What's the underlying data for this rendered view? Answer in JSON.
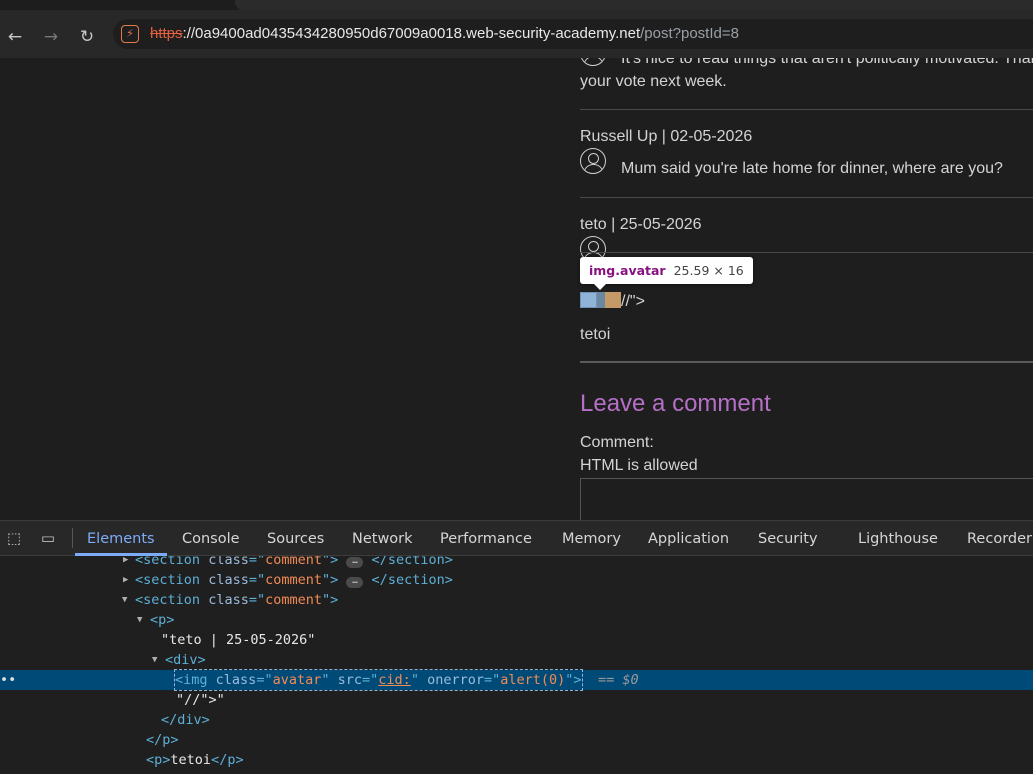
{
  "browser": {
    "url_scheme": "https",
    "url_host": "://0a9400ad0435434280950d67009a0018.web-security-academy.net",
    "url_path": "/post?postId=8"
  },
  "page": {
    "partial_comment_line1": "It's nice to read things that aren't politically motivated. Than",
    "partial_comment_line2": "your vote next week.",
    "comment2_header": "Russell Up | 02-05-2026",
    "comment2_body": "Mum said you're late home for dinner, where are you?",
    "comment3_header": "teto | 25-05-2026",
    "comment3_injected_text": "//\">",
    "comment3_body": "tetoi",
    "leave_comment_heading": "Leave a comment",
    "comment_label": "Comment:",
    "html_allowed_label": "HTML is allowed"
  },
  "tooltip": {
    "tag": "img.avatar",
    "dimensions": "25.59 × 16"
  },
  "devtools": {
    "tabs": [
      "Elements",
      "Console",
      "Sources",
      "Network",
      "Performance",
      "Memory",
      "Application",
      "Security",
      "Lighthouse",
      "Recorder"
    ],
    "tree": {
      "section_tag": "section",
      "class_attr": "class",
      "comment_class": "comment",
      "ellipsis": "…",
      "p_tag": "p",
      "teto_text": "\"teto | 25-05-2026\"",
      "div_tag": "div",
      "img_tag": "img",
      "avatar_class": "avatar",
      "src_attr": "src",
      "src_value": "cid:",
      "onerror_attr": "onerror",
      "onerror_value": "alert(0)",
      "dollar0": "== $0",
      "injected_text_node": "\"//\">\"",
      "tetoi_text": "tetoi",
      "more_dots": "••"
    }
  }
}
